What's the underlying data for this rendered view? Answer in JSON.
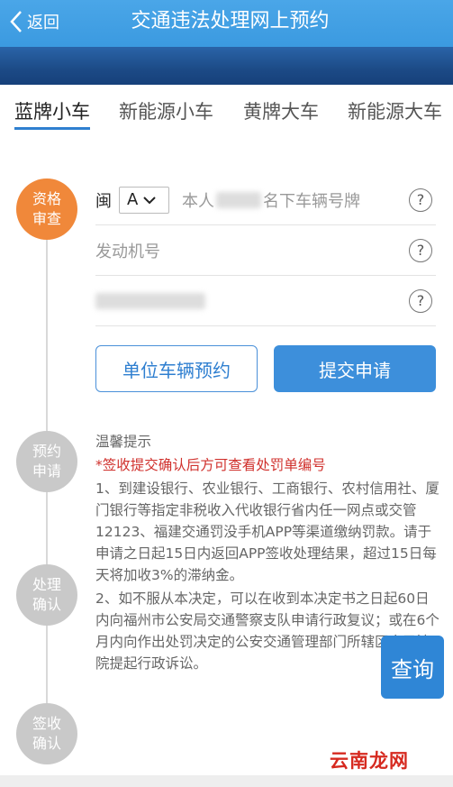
{
  "header": {
    "back_label": "返回",
    "title": "交通违法处理网上预约"
  },
  "tabs": [
    "蓝牌小车",
    "新能源小车",
    "黄牌大车",
    "新能源大车"
  ],
  "steps": [
    {
      "line1": "资格",
      "line2": "审查"
    },
    {
      "line1": "预约",
      "line2": "申请"
    },
    {
      "line1": "处理",
      "line2": "确认"
    },
    {
      "line1": "签收",
      "line2": "确认"
    }
  ],
  "form": {
    "province": "闽",
    "letter": "A",
    "plate_placeholder_pre": "本人",
    "plate_placeholder_post": "名下车辆号牌",
    "engine_placeholder": "发动机号",
    "help": "?"
  },
  "buttons": {
    "unit": "单位车辆预约",
    "submit": "提交申请"
  },
  "tips": {
    "title": "温馨提示",
    "warning": "*签收提交确认后方可查看处罚单编号",
    "p1": "1、到建设银行、农业银行、工商银行、农村信用社、厦门银行等指定非税收入代收银行省内任一网点或交管12123、福建交通罚没手机APP等渠道缴纳罚款。请于申请之日起15日内返回APP签收处理结果，超过15日每天将加收3%的滞纳金。",
    "p2": "2、如不服从本决定，可以在收到本决定书之日起60日内向福州市公安局交通警察支队申请行政复议；或在6个月内向作出处罚决定的公安交通管理部门所辖区人民法院提起行政诉讼。"
  },
  "query_label": "查询",
  "watermark": "云南龙网"
}
